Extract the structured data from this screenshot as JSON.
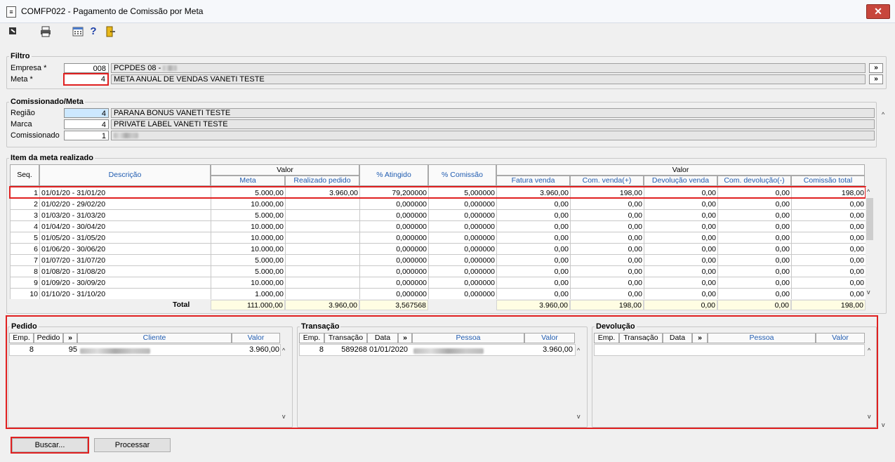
{
  "window": {
    "title": "COMFP022 - Pagamento de Comissão por Meta",
    "close": "✕"
  },
  "toolbar": {
    "icons": [
      "exit-icon",
      "print-icon",
      "calculator-icon",
      "help-icon",
      "door-exit-icon"
    ],
    "help": "?"
  },
  "filtro": {
    "label": "Filtro",
    "empresa_label": "Empresa *",
    "empresa_value": "008",
    "empresa_desc": "PCPDES 08 -",
    "meta_label": "Meta *",
    "meta_value": "4",
    "meta_desc": "META ANUAL DE VENDAS VANETI TESTE",
    "lookup": "»"
  },
  "comissionado": {
    "label": "Comissionado/Meta",
    "regiao_label": "Região",
    "regiao_value": "4",
    "regiao_desc": "PARANA BONUS VANETI TESTE",
    "marca_label": "Marca",
    "marca_value": "4",
    "marca_desc": "PRIVATE LABEL VANETI TESTE",
    "comissionado_label": "Comissionado",
    "comissionado_value": "1"
  },
  "itens": {
    "label": "Item da meta realizado",
    "headers": {
      "seq": "Seq.",
      "descricao": "Descrição",
      "valor1": "Valor",
      "meta": "Meta",
      "realizado": "Realizado pedido",
      "atingido": "% Atingido",
      "comissao_pct": "% Comissão",
      "valor2": "Valor",
      "fatura": "Fatura venda",
      "com_venda": "Com. venda(+)",
      "devolucao": "Devolução venda",
      "com_dev": "Com. devolução(-)",
      "com_total": "Comissão total"
    },
    "rows": [
      [
        "1",
        "01/01/20 - 31/01/20",
        "5.000,00",
        "3.960,00",
        "79,200000",
        "5,000000",
        "3.960,00",
        "198,00",
        "0,00",
        "0,00",
        "198,00"
      ],
      [
        "2",
        "01/02/20 - 29/02/20",
        "10.000,00",
        "",
        "0,000000",
        "0,000000",
        "0,00",
        "0,00",
        "0,00",
        "0,00",
        "0,00"
      ],
      [
        "3",
        "01/03/20 - 31/03/20",
        "5.000,00",
        "",
        "0,000000",
        "0,000000",
        "0,00",
        "0,00",
        "0,00",
        "0,00",
        "0,00"
      ],
      [
        "4",
        "01/04/20 - 30/04/20",
        "10.000,00",
        "",
        "0,000000",
        "0,000000",
        "0,00",
        "0,00",
        "0,00",
        "0,00",
        "0,00"
      ],
      [
        "5",
        "01/05/20 - 31/05/20",
        "10.000,00",
        "",
        "0,000000",
        "0,000000",
        "0,00",
        "0,00",
        "0,00",
        "0,00",
        "0,00"
      ],
      [
        "6",
        "01/06/20 - 30/06/20",
        "10.000,00",
        "",
        "0,000000",
        "0,000000",
        "0,00",
        "0,00",
        "0,00",
        "0,00",
        "0,00"
      ],
      [
        "7",
        "01/07/20 - 31/07/20",
        "5.000,00",
        "",
        "0,000000",
        "0,000000",
        "0,00",
        "0,00",
        "0,00",
        "0,00",
        "0,00"
      ],
      [
        "8",
        "01/08/20 - 31/08/20",
        "5.000,00",
        "",
        "0,000000",
        "0,000000",
        "0,00",
        "0,00",
        "0,00",
        "0,00",
        "0,00"
      ],
      [
        "9",
        "01/09/20 - 30/09/20",
        "10.000,00",
        "",
        "0,000000",
        "0,000000",
        "0,00",
        "0,00",
        "0,00",
        "0,00",
        "0,00"
      ],
      [
        "10",
        "01/10/20 - 31/10/20",
        "1.000,00",
        "",
        "0,000000",
        "0,000000",
        "0,00",
        "0,00",
        "0,00",
        "0,00",
        "0,00"
      ]
    ],
    "total": {
      "label": "Total",
      "meta": "111.000,00",
      "realizado": "3.960,00",
      "atingido": "3,567568",
      "fatura": "3.960,00",
      "com_venda": "198,00",
      "devolucao": "0,00",
      "com_dev": "0,00",
      "com_total": "198,00"
    }
  },
  "pedido": {
    "label": "Pedido",
    "headers": {
      "emp": "Emp.",
      "pedido": "Pedido",
      "more": "»",
      "cliente": "Cliente",
      "valor": "Valor"
    },
    "row": {
      "emp": "8",
      "pedido": "95",
      "valor": "3.960,00"
    }
  },
  "transacao": {
    "label": "Transação",
    "headers": {
      "emp": "Emp.",
      "transacao": "Transação",
      "data": "Data",
      "more": "»",
      "pessoa": "Pessoa",
      "valor": "Valor"
    },
    "row": {
      "emp": "8",
      "transacao": "589268",
      "data": "01/01/2020",
      "valor": "3.960,00"
    }
  },
  "devolucao": {
    "label": "Devolução",
    "headers": {
      "emp": "Emp.",
      "transacao": "Transação",
      "data": "Data",
      "more": "»",
      "pessoa": "Pessoa",
      "valor": "Valor"
    }
  },
  "buttons": {
    "buscar": "Buscar...",
    "processar": "Processar"
  },
  "colors": {
    "highlight_red": "#e02020",
    "selected_cell": "#cce8ff",
    "total_bg": "#fffde3"
  }
}
